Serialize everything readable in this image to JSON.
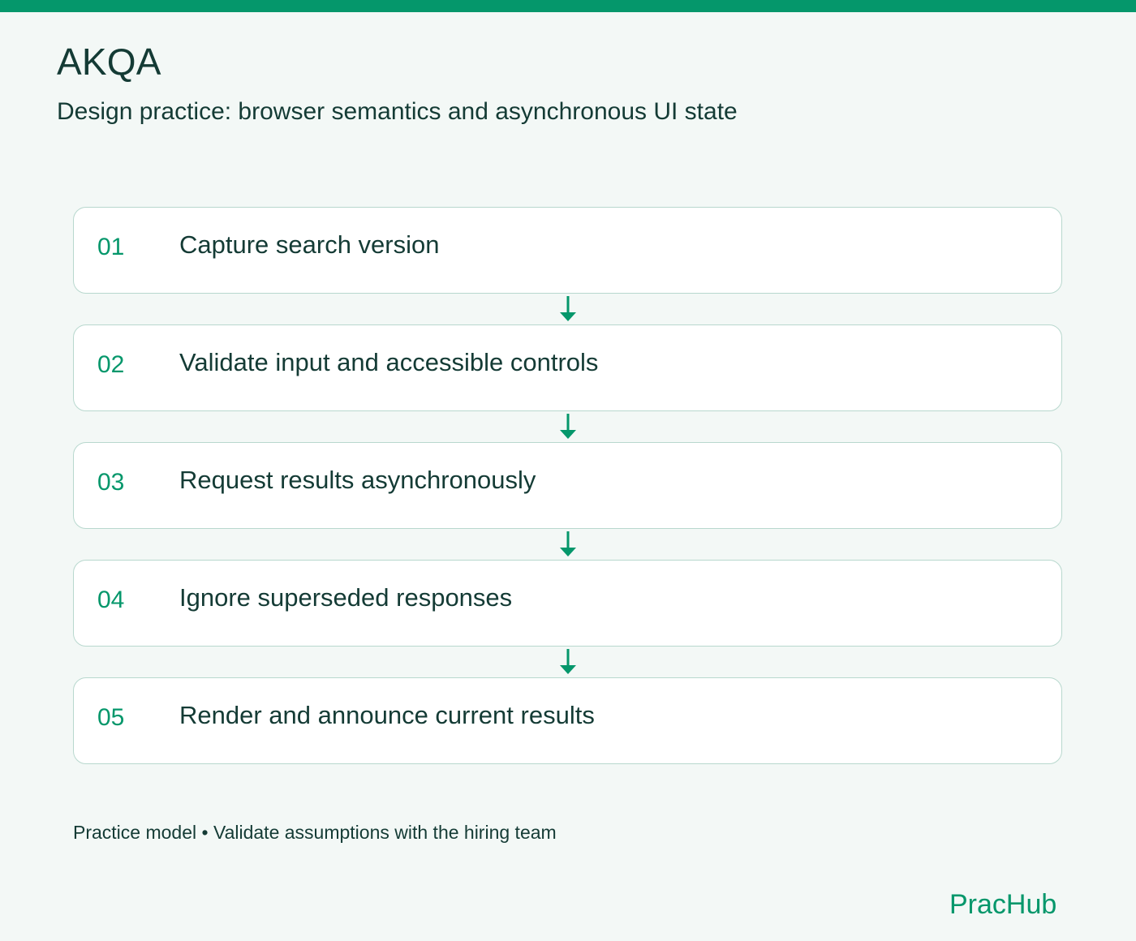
{
  "header": {
    "company": "AKQA",
    "subtitle": "Design practice: browser semantics and asynchronous UI state"
  },
  "steps": [
    {
      "number": "01",
      "label": "Capture search version"
    },
    {
      "number": "02",
      "label": "Validate input and accessible controls"
    },
    {
      "number": "03",
      "label": "Request results asynchronously"
    },
    {
      "number": "04",
      "label": "Ignore superseded responses"
    },
    {
      "number": "05",
      "label": "Render and announce current results"
    }
  ],
  "footer": {
    "note": "Practice model • Validate assumptions with the hiring team"
  },
  "brand": {
    "name": "PracHub"
  },
  "colors": {
    "accent": "#05976b",
    "background": "#f3f8f6",
    "text": "#143b35",
    "card_border": "#b8d8ce",
    "card_background": "#ffffff"
  }
}
